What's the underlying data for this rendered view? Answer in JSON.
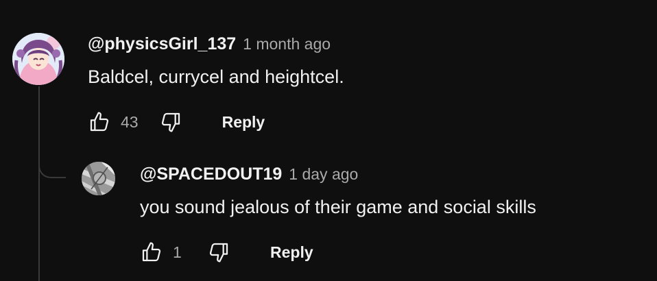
{
  "comments": [
    {
      "author": "@physicsGirl_137",
      "time": "1 month ago",
      "text": "Baldcel, currycel and heightcel.",
      "likes": "43",
      "reply_label": "Reply",
      "avatar_icon": "anime-girl-avatar"
    },
    {
      "author": "@SPACEDOUT19",
      "time": "1 day ago",
      "text": "you sound jealous of their game and social skills",
      "likes": "1",
      "reply_label": "Reply",
      "avatar_icon": "grey-abstract-avatar"
    }
  ],
  "colors": {
    "background": "#0f0f0f",
    "text": "#f1f1f1",
    "secondary_text": "#aaaaaa",
    "thread_line": "#3a3a3a"
  }
}
